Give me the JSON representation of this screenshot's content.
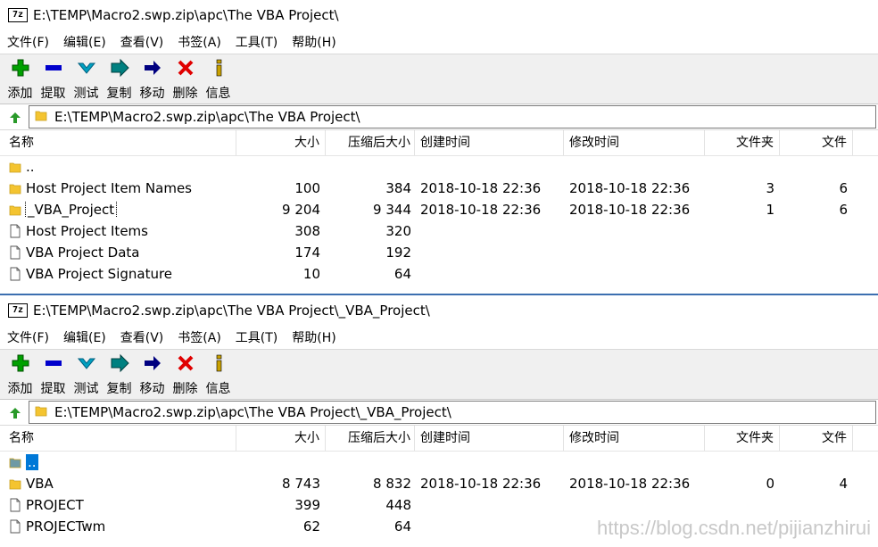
{
  "menu": [
    "文件(F)",
    "编辑(E)",
    "查看(V)",
    "书签(A)",
    "工具(T)",
    "帮助(H)"
  ],
  "toolbar": [
    {
      "icon": "add-icon",
      "label": "添加",
      "color": "#00a000"
    },
    {
      "icon": "extract-icon",
      "label": "提取",
      "color": "#0000cc"
    },
    {
      "icon": "test-icon",
      "label": "测试",
      "color": "#00a0c0"
    },
    {
      "icon": "copy-icon",
      "label": "复制",
      "color": "#008080"
    },
    {
      "icon": "move-icon",
      "label": "移动",
      "color": "#000080"
    },
    {
      "icon": "delete-icon",
      "label": "删除",
      "color": "#e00000"
    },
    {
      "icon": "info-icon",
      "label": "信息",
      "color": "#c8a000"
    }
  ],
  "columns": [
    "名称",
    "大小",
    "压缩后大小",
    "创建时间",
    "修改时间",
    "文件夹",
    "文件"
  ],
  "window1": {
    "title": "E:\\TEMP\\Macro2.swp.zip\\apc\\The VBA Project\\",
    "address": "E:\\TEMP\\Macro2.swp.zip\\apc\\The VBA Project\\",
    "rows": [
      {
        "type": "folder",
        "name": "..",
        "size": "",
        "packed": "",
        "created": "",
        "modified": "",
        "folders": "",
        "files": ""
      },
      {
        "type": "folder",
        "name": "Host Project Item Names",
        "size": "100",
        "packed": "384",
        "created": "2018-10-18 22:36",
        "modified": "2018-10-18 22:36",
        "folders": "3",
        "files": "6"
      },
      {
        "type": "folder",
        "name": "_VBA_Project",
        "size": "9 204",
        "packed": "9 344",
        "created": "2018-10-18 22:36",
        "modified": "2018-10-18 22:36",
        "folders": "1",
        "files": "6",
        "focus": true
      },
      {
        "type": "file",
        "name": "Host Project Items",
        "size": "308",
        "packed": "320",
        "created": "",
        "modified": "",
        "folders": "",
        "files": ""
      },
      {
        "type": "file",
        "name": "VBA Project Data",
        "size": "174",
        "packed": "192",
        "created": "",
        "modified": "",
        "folders": "",
        "files": ""
      },
      {
        "type": "file",
        "name": "VBA Project Signature",
        "size": "10",
        "packed": "64",
        "created": "",
        "modified": "",
        "folders": "",
        "files": ""
      }
    ]
  },
  "window2": {
    "title": "E:\\TEMP\\Macro2.swp.zip\\apc\\The VBA Project\\_VBA_Project\\",
    "address": "E:\\TEMP\\Macro2.swp.zip\\apc\\The VBA Project\\_VBA_Project\\",
    "rows": [
      {
        "type": "folder",
        "name": "..",
        "size": "",
        "packed": "",
        "created": "",
        "modified": "",
        "folders": "",
        "files": "",
        "selected": true
      },
      {
        "type": "folder",
        "name": "VBA",
        "size": "8 743",
        "packed": "8 832",
        "created": "2018-10-18 22:36",
        "modified": "2018-10-18 22:36",
        "folders": "0",
        "files": "4"
      },
      {
        "type": "file",
        "name": "PROJECT",
        "size": "399",
        "packed": "448",
        "created": "",
        "modified": "",
        "folders": "",
        "files": ""
      },
      {
        "type": "file",
        "name": "PROJECTwm",
        "size": "62",
        "packed": "64",
        "created": "",
        "modified": "",
        "folders": "",
        "files": ""
      }
    ]
  },
  "watermark": "https://blog.csdn.net/pijianzhirui",
  "app_icon_text": "7z",
  "colors": {
    "folder": "#f4c430",
    "selection": "#0078d7",
    "accent": "#3c6fb0"
  }
}
